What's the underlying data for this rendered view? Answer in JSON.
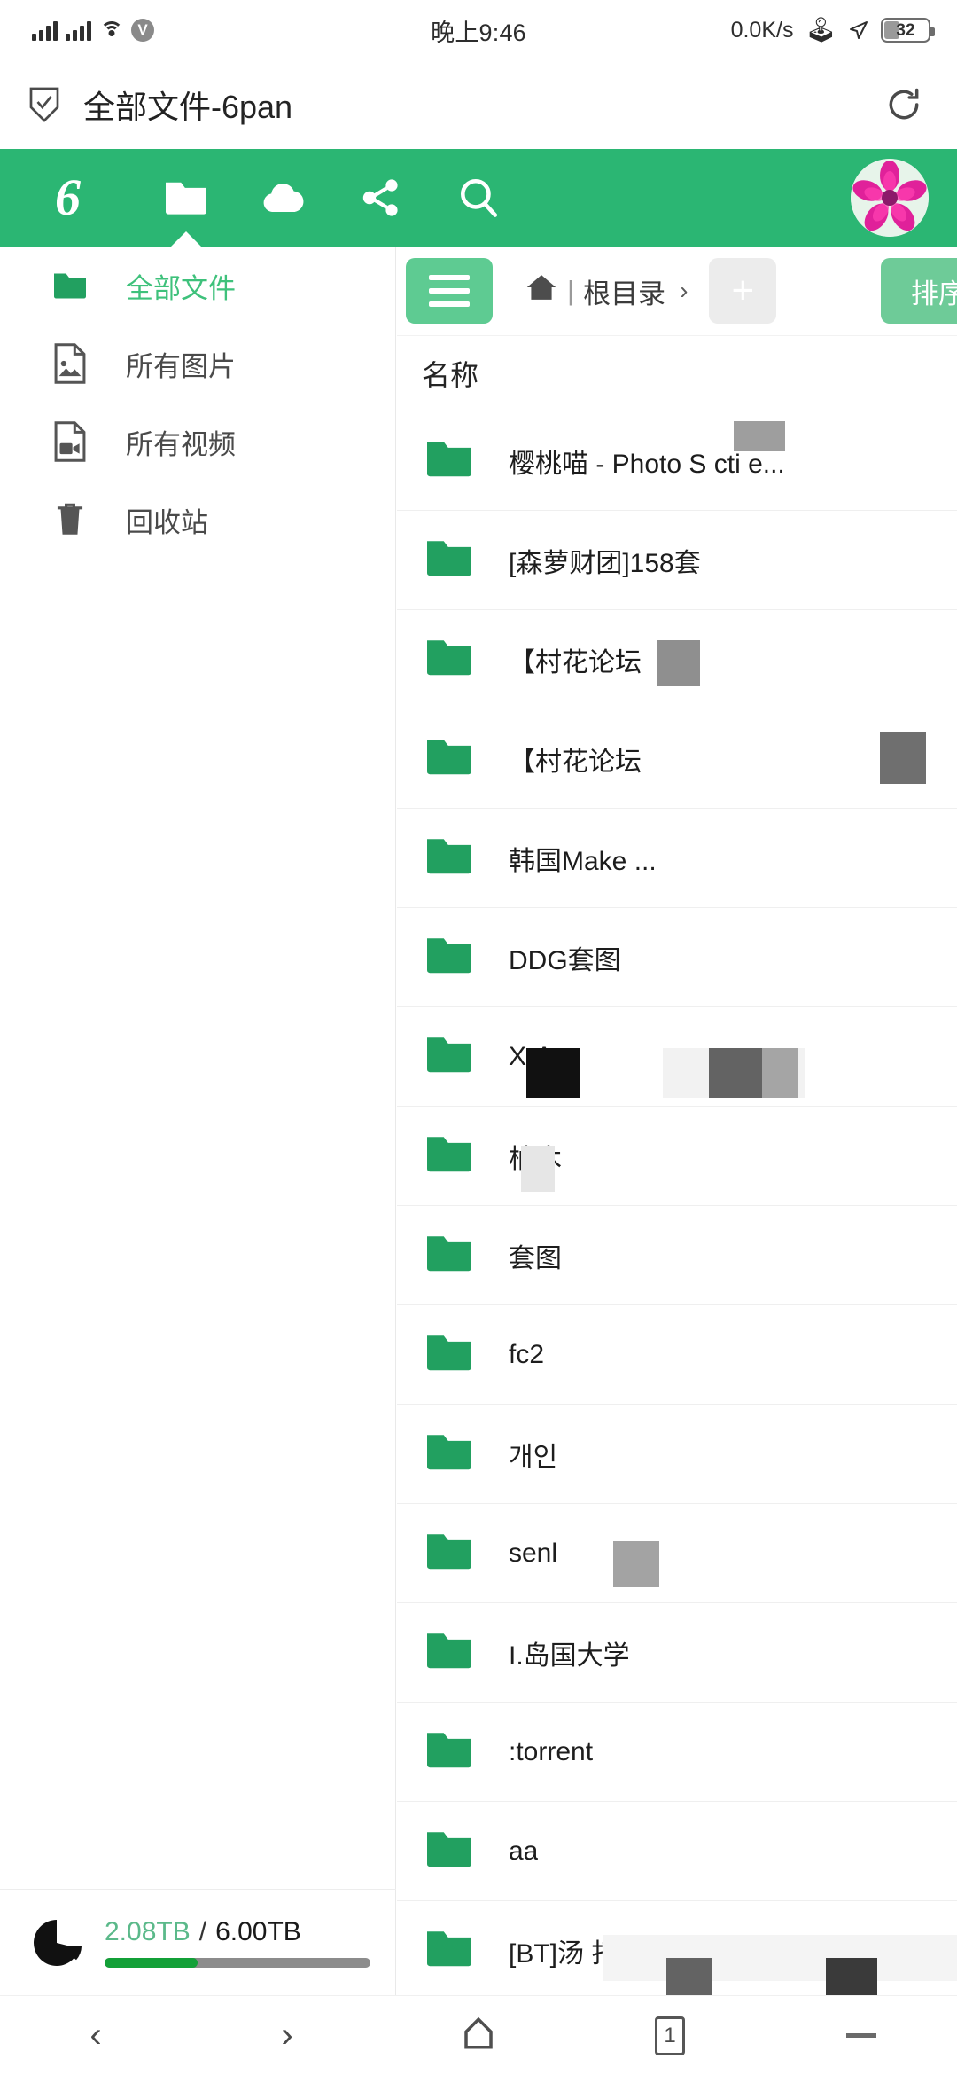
{
  "status_bar": {
    "signal_icon": "signal-bars-icon",
    "signal_icon_2": "signal-bars-icon-2",
    "wifi_icon": "wifi-icon",
    "carrier_badge": "V",
    "time": "晚上9:46",
    "net_speed": "0.0K/s",
    "bluetooth_icon": "bluetooth-icon",
    "location_icon": "location-arrow-icon",
    "battery_level": "32",
    "battery_percent": 32
  },
  "title_bar": {
    "shield_icon": "shield-check-icon",
    "title": "全部文件-6pan",
    "refresh_icon": "refresh-icon"
  },
  "toolbar": {
    "logo": "6",
    "items": [
      {
        "name": "files-tab",
        "icon": "folder-icon",
        "active": true
      },
      {
        "name": "cloud-tab",
        "icon": "cloud-icon",
        "active": false
      },
      {
        "name": "share-tab",
        "icon": "share-icon",
        "active": false
      },
      {
        "name": "search-tab",
        "icon": "search-icon",
        "active": false
      }
    ],
    "avatar": "user-avatar-flower"
  },
  "sidebar": {
    "items": [
      {
        "label": "全部文件",
        "icon": "folder-icon",
        "active": true
      },
      {
        "label": "所有图片",
        "icon": "image-file-icon",
        "active": false
      },
      {
        "label": "所有视频",
        "icon": "video-file-icon",
        "active": false
      },
      {
        "label": "回收站",
        "icon": "trash-icon",
        "active": false
      }
    ],
    "storage": {
      "pie_icon": "pie-chart-icon",
      "used": "2.08TB",
      "separator": "/",
      "total": "6.00TB",
      "used_percent": 35,
      "used_color": "#13a038"
    }
  },
  "file_pane": {
    "menu_button_icon": "hamburger-menu-icon",
    "breadcrumb": {
      "home_icon": "home-icon",
      "divider": "|",
      "root_label": "根目录",
      "chevron": "›"
    },
    "add_button_label": "+",
    "sort_button_label": "排序",
    "column_headers": [
      "名称"
    ],
    "rows": [
      {
        "name": "樱桃喵 - Photo S",
        "suffix": "cti        e...",
        "icon": "folder-icon"
      },
      {
        "name": "[森萝财团]158套",
        "suffix": "",
        "icon": "folder-icon"
      },
      {
        "name": "【村花论坛",
        "suffix": "",
        "icon": "folder-icon"
      },
      {
        "name": "【村花论坛",
        "suffix": "",
        "icon": "folder-icon"
      },
      {
        "name": "韩国Make",
        "suffix": "...",
        "icon": "folder-icon"
      },
      {
        "name": "DDG套图",
        "suffix": "",
        "icon": "folder-icon"
      },
      {
        "name": "X-A",
        "suffix": "",
        "icon": "folder-icon"
      },
      {
        "name": "柚木",
        "suffix": "",
        "icon": "folder-icon"
      },
      {
        "name": "套图",
        "suffix": "",
        "icon": "folder-icon"
      },
      {
        "name": "fc2",
        "suffix": "",
        "icon": "folder-icon"
      },
      {
        "name": "개인",
        "suffix": "",
        "icon": "folder-icon"
      },
      {
        "name": "senl",
        "suffix": "",
        "icon": "folder-icon"
      },
      {
        "name": "I.岛国大学",
        "suffix": "",
        "icon": "folder-icon"
      },
      {
        "name": ":torrent",
        "suffix": "",
        "icon": "folder-icon"
      },
      {
        "name": "aa",
        "suffix": "",
        "icon": "folder-icon"
      },
      {
        "name": "[BT]汤",
        "suffix": "打...",
        "icon": "folder-icon"
      }
    ]
  },
  "nav_bar": {
    "back_icon": "chevron-left-icon",
    "forward_icon": "chevron-right-icon",
    "home_icon": "home-outline-icon",
    "tabs_count": "1",
    "minimize_icon": "minimize-icon"
  },
  "colors": {
    "brand_green": "#2bb673",
    "folder_green": "#22a060",
    "accent_light_green": "#6ecb98",
    "sidebar_active": "#3ec17b"
  }
}
